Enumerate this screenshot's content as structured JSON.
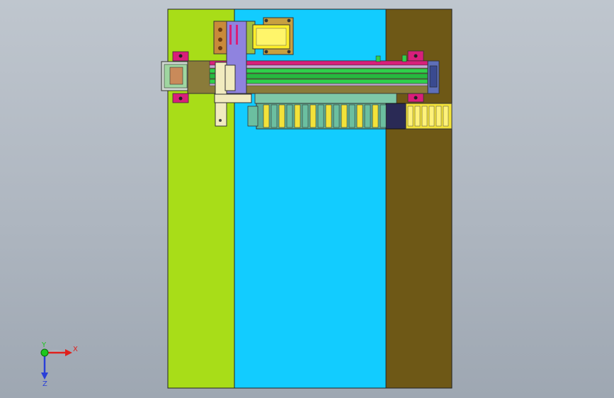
{
  "colors": {
    "viewport_top": "#bfc6ce",
    "viewport_bottom": "#9ea7b2",
    "panel_left": "#a8dd18",
    "panel_center": "#12ccff",
    "panel_right": "#6e5816",
    "magenta": "#d81f7a",
    "green_rail": "#2fd14b",
    "slider_purple": "#8f83df",
    "block_yellow": "#ffee2a",
    "chain_teal": "#6bbfa0",
    "chain_yellow": "#f2e23a",
    "chain_dark": "#2a2a55",
    "axis_x": "#e0201c",
    "axis_y": "#1ec81e",
    "axis_z": "#2a3fd8"
  },
  "triad": {
    "x_label": "X",
    "y_label": "Y",
    "z_label": "Z"
  }
}
